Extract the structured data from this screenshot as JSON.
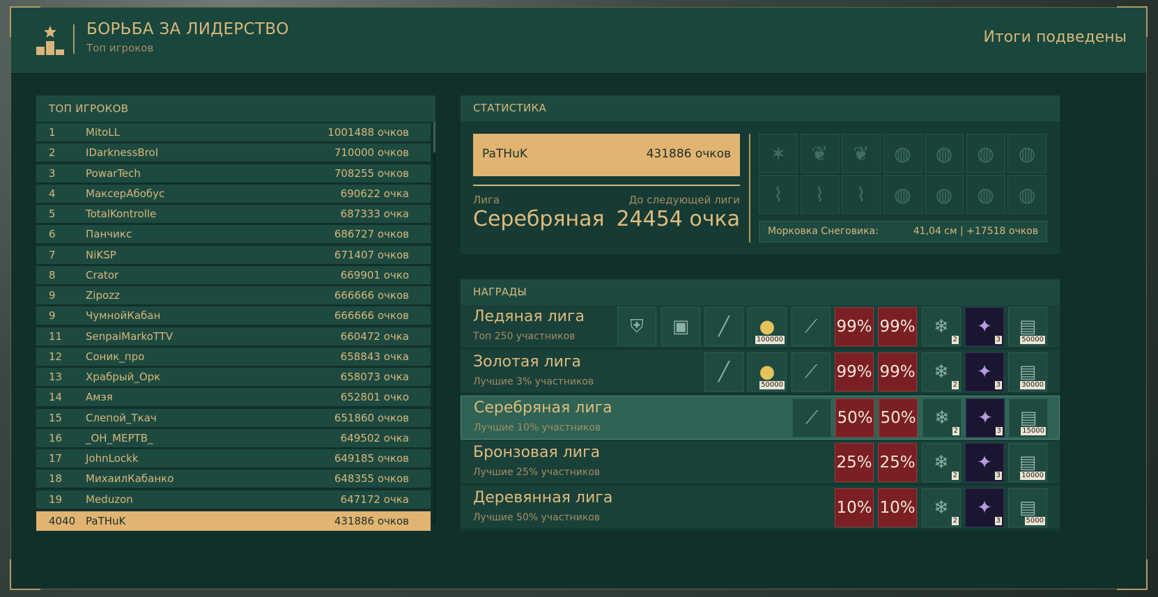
{
  "header": {
    "title": "БОРЬБА ЗА ЛИДЕРСТВО",
    "subtitle": "Топ игроков",
    "status": "Итоги подведены"
  },
  "leaderboard": {
    "title": "ТОП ИГРОКОВ",
    "rows": [
      {
        "rank": "1",
        "name": "MitoLL",
        "score": "1001488 очков"
      },
      {
        "rank": "2",
        "name": "IDarknessBroI",
        "score": "710000 очков"
      },
      {
        "rank": "3",
        "name": "PowarTech",
        "score": "708255 очков"
      },
      {
        "rank": "4",
        "name": "МаксерАбобус",
        "score": "690622 очка"
      },
      {
        "rank": "5",
        "name": "TotalKontrolle",
        "score": "687333 очка"
      },
      {
        "rank": "6",
        "name": "Панчикс",
        "score": "686727 очков"
      },
      {
        "rank": "7",
        "name": "NiKSP",
        "score": "671407 очков"
      },
      {
        "rank": "8",
        "name": "Crator",
        "score": "669901 очко"
      },
      {
        "rank": "9",
        "name": "Zipozz",
        "score": "666666 очков"
      },
      {
        "rank": "9",
        "name": "ЧумнойКабан",
        "score": "666666 очков"
      },
      {
        "rank": "11",
        "name": "SenpaiMarkoTTV",
        "score": "660472 очка"
      },
      {
        "rank": "12",
        "name": "Соник_про",
        "score": "658843 очка"
      },
      {
        "rank": "13",
        "name": "Храбрый_Орк",
        "score": "658073 очка"
      },
      {
        "rank": "14",
        "name": "Амэя",
        "score": "652801 очко"
      },
      {
        "rank": "15",
        "name": "Слепой_Ткач",
        "score": "651860 очков"
      },
      {
        "rank": "16",
        "name": "_ОН_МЕРТВ_",
        "score": "649502 очка"
      },
      {
        "rank": "17",
        "name": "JohnLockk",
        "score": "649185 очков"
      },
      {
        "rank": "18",
        "name": "МихаилКабанко",
        "score": "648355 очков"
      },
      {
        "rank": "19",
        "name": "Meduzon",
        "score": "647172 очка"
      }
    ],
    "me": {
      "rank": "4040",
      "name": "PaTHuK",
      "score": "431886 очков"
    }
  },
  "stats": {
    "title": "СТАТИСТИКА",
    "player_name": "PaTHuK",
    "player_score": "431886 очков",
    "league_caption": "Лига",
    "league_value": "Серебряная",
    "next_caption": "До следующей лиги",
    "next_value": "24454 очка",
    "carrot_label": "Морковка Снеговика:",
    "carrot_value": "41,04 см | +17518 очков",
    "decorations": [
      "star-icon",
      "branch-icon",
      "branch-icon",
      "ornament-icon",
      "ornament-icon",
      "ornament-icon",
      "ornament-icon",
      "garland-icon",
      "garland-icon",
      "garland-icon",
      "ornament-icon",
      "ornament-icon",
      "ornament-icon",
      "ornament-icon"
    ]
  },
  "rewards": {
    "title": "НАГРАДЫ",
    "leagues": [
      {
        "name": "Ледяная лига",
        "desc": "Топ 250 участников",
        "coins": "100000",
        "pct1": "99%",
        "pct2": "99%",
        "medal_count": "2",
        "box_count": "3",
        "map_value": "50000"
      },
      {
        "name": "Золотая лига",
        "desc": "Лучшие 3% участников",
        "coins": "50000",
        "pct1": "99%",
        "pct2": "99%",
        "medal_count": "2",
        "box_count": "3",
        "map_value": "30000"
      },
      {
        "name": "Серебряная лига",
        "desc": "Лучшие 10% участников",
        "pct1": "50%",
        "pct2": "50%",
        "medal_count": "2",
        "box_count": "3",
        "map_value": "15000"
      },
      {
        "name": "Бронзовая лига",
        "desc": "Лучшие 25% участников",
        "pct1": "25%",
        "pct2": "25%",
        "medal_count": "2",
        "box_count": "3",
        "map_value": "10000"
      },
      {
        "name": "Деревянная лига",
        "desc": "Лучшие 50% участников",
        "pct1": "10%",
        "pct2": "10%",
        "medal_count": "2",
        "box_count": "3",
        "map_value": "5000"
      }
    ]
  }
}
